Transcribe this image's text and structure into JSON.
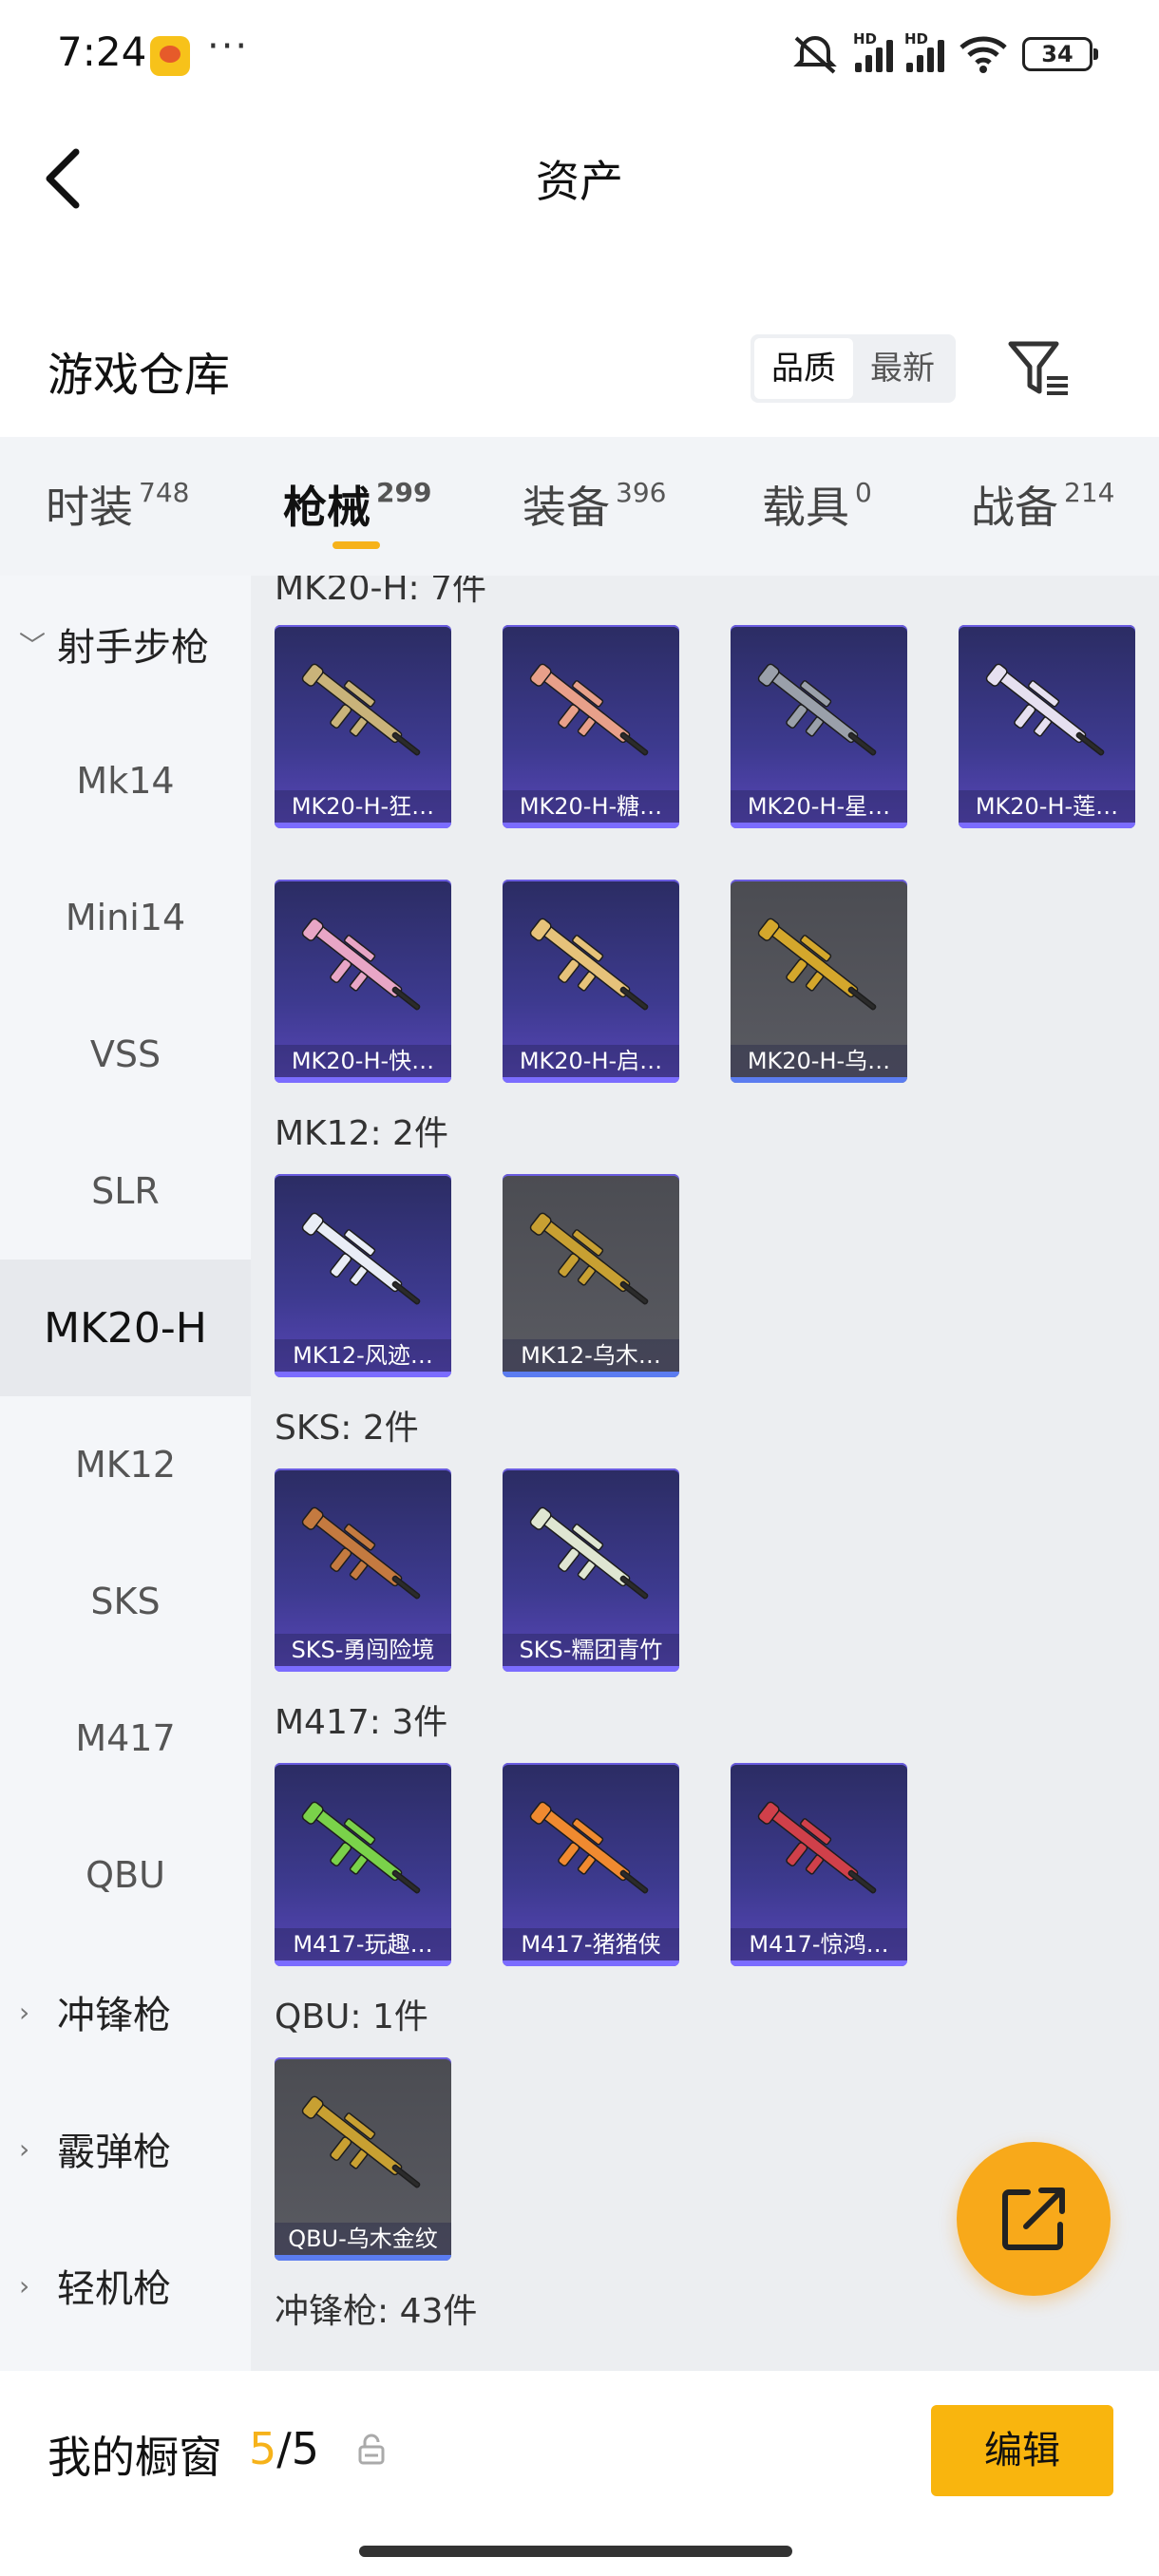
{
  "status": {
    "time": "7:24",
    "dots": "···",
    "hd1": "HD",
    "hd2": "HD",
    "battery": "34"
  },
  "header": {
    "title": "资产"
  },
  "warehouse": {
    "title": "游戏仓库",
    "sort_quality": "品质",
    "sort_newest": "最新"
  },
  "tabs": [
    {
      "label": "时装",
      "count": "748"
    },
    {
      "label": "枪械",
      "count": "299"
    },
    {
      "label": "装备",
      "count": "396"
    },
    {
      "label": "载具",
      "count": "0"
    },
    {
      "label": "战备",
      "count": "214"
    }
  ],
  "sidebar": {
    "items": [
      {
        "label": "射手步枪"
      },
      {
        "label": "Mk14"
      },
      {
        "label": "Mini14"
      },
      {
        "label": "VSS"
      },
      {
        "label": "SLR"
      },
      {
        "label": "MK20-H"
      },
      {
        "label": "MK12"
      },
      {
        "label": "SKS"
      },
      {
        "label": "M417"
      },
      {
        "label": "QBU"
      },
      {
        "label": "冲锋枪"
      },
      {
        "label": "霰弹枪"
      },
      {
        "label": "轻机枪"
      }
    ]
  },
  "sections": {
    "mk20h": "MK20-H: 7件",
    "mk12": "MK12: 2件",
    "sks": "SKS: 2件",
    "m417": "M417: 3件",
    "qbu": "QBU: 1件",
    "smg": "冲锋枪: 43件"
  },
  "cards": [
    {
      "name": "MK20-H-狂…",
      "accent": "#c9b37a"
    },
    {
      "name": "MK20-H-糖…",
      "accent": "#e8a08a"
    },
    {
      "name": "MK20-H-星…",
      "accent": "#9aa0aa"
    },
    {
      "name": "MK20-H-莲…",
      "accent": "#e6e0f0"
    },
    {
      "name": "MK20-H-快…",
      "accent": "#e8a6c6"
    },
    {
      "name": "MK20-H-启…",
      "accent": "#e6c27a"
    },
    {
      "name": "MK20-H-乌…",
      "accent": "#d4a72c"
    },
    {
      "name": "MK12-风迹…",
      "accent": "#e9edf6"
    },
    {
      "name": "MK12-乌木…",
      "accent": "#c8a032"
    },
    {
      "name": "SKS-勇闯险境",
      "accent": "#c47a40"
    },
    {
      "name": "SKS-糯团青竹",
      "accent": "#dfe6d2"
    },
    {
      "name": "M417-玩趣…",
      "accent": "#7ad24a"
    },
    {
      "name": "M417-猪猪侠",
      "accent": "#f08a30"
    },
    {
      "name": "M417-惊鸿…",
      "accent": "#d0404a"
    },
    {
      "name": "QBU-乌木金纹",
      "accent": "#c8a032"
    }
  ],
  "showcase": {
    "label": "我的橱窗",
    "current": "5",
    "total": "/5",
    "edit": "编辑"
  }
}
